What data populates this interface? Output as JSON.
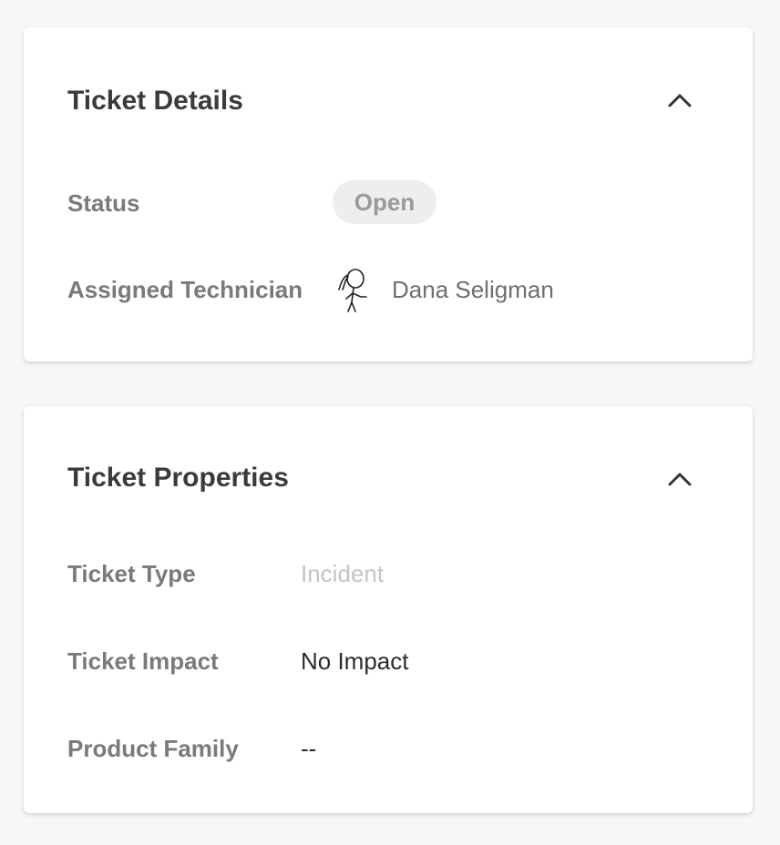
{
  "details": {
    "title": "Ticket Details",
    "status_label": "Status",
    "status_value": "Open",
    "technician_label": "Assigned Technician",
    "technician_name": "Dana Seligman"
  },
  "properties": {
    "title": "Ticket Properties",
    "fields": [
      {
        "label": "Ticket Type",
        "value": "Incident"
      },
      {
        "label": "Ticket Impact",
        "value": "No Impact"
      },
      {
        "label": "Product Family",
        "value": "--"
      }
    ]
  },
  "icons": {
    "collapse": "chevron-up-icon",
    "avatar": "avatar-stick-figure"
  }
}
